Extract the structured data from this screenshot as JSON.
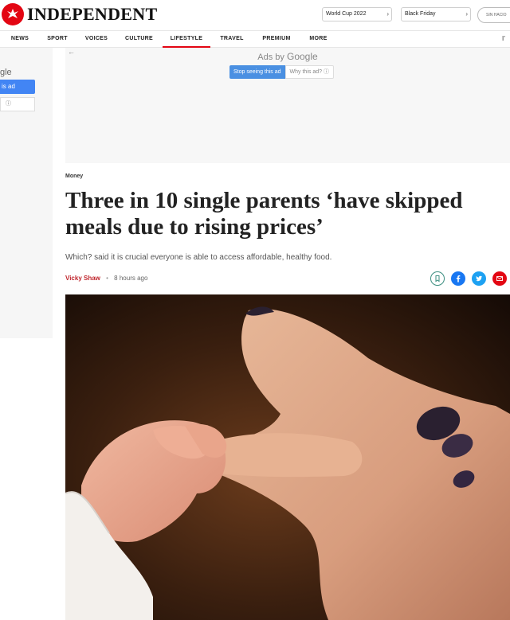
{
  "header": {
    "brand": "INDEPENDENT",
    "pills": [
      "World Cup 2022",
      "Black Friday"
    ],
    "round_pill": "SIN HACIO"
  },
  "nav": {
    "items": [
      "NEWS",
      "SPORT",
      "VOICES",
      "CULTURE",
      "LIFESTYLE",
      "TRAVEL",
      "PREMIUM",
      "MORE"
    ],
    "active": "LIFESTYLE",
    "extra": "I’"
  },
  "left_ad": {
    "google_fragment": "gle",
    "stop_fragment": "is ad",
    "why_fragment": "ⓘ"
  },
  "ad": {
    "ads_by": "Ads by",
    "google": "Google",
    "stop_seeing": "Stop seeing this ad",
    "why": "Why this ad? ⓘ",
    "back_arrow": "←"
  },
  "article": {
    "category": "Money",
    "headline": "Three in 10 single parents ‘have skipped meals due to rising prices’",
    "standfirst": "Which? said it is crucial everyone is able to access affordable, healthy food.",
    "author": "Vicky Shaw",
    "timestamp": "8 hours ago"
  },
  "share": {
    "icons": [
      "bookmark-icon",
      "facebook-icon",
      "twitter-icon",
      "email-icon"
    ]
  },
  "colors": {
    "brand_red": "#e30613",
    "author_red": "#c0262d",
    "facebook": "#1877f2",
    "twitter": "#1da1f2",
    "ad_blue": "#4a90e2"
  }
}
